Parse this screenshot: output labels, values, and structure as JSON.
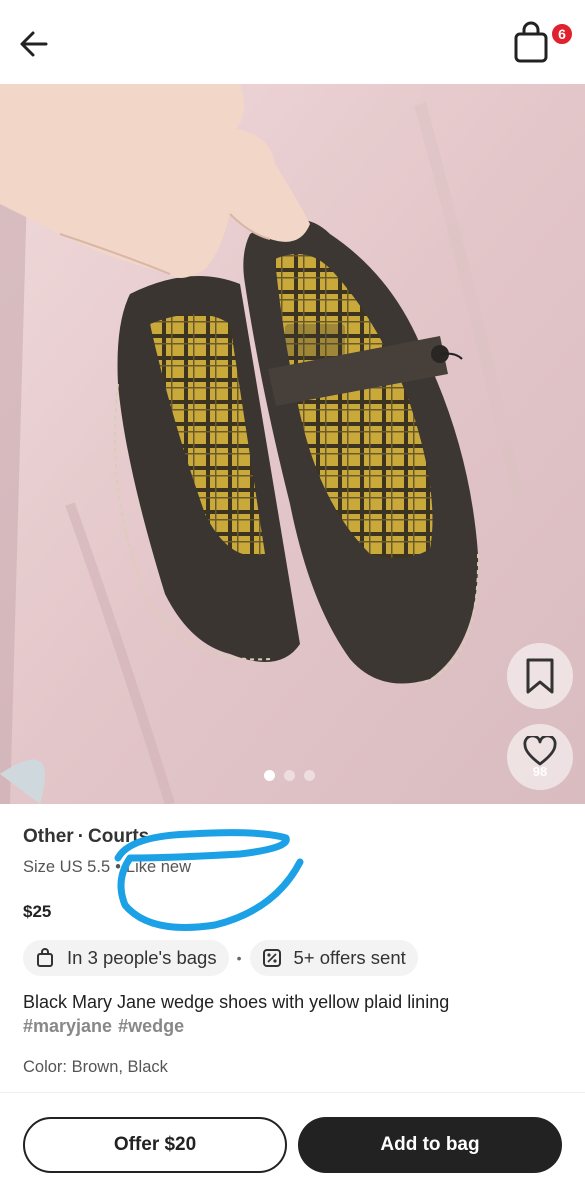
{
  "header": {
    "back_icon": "arrow-left-icon",
    "bag_icon": "shopping-bag-icon",
    "bag_count": "6",
    "badge_color": "#e0212e"
  },
  "gallery": {
    "image_count": 3,
    "active_index": 0,
    "save_icon": "bookmark-icon",
    "like_icon": "heart-icon",
    "like_count": "98"
  },
  "product": {
    "brand": "Other",
    "category": "Courts",
    "separator": "·",
    "size": "Size US 5.5",
    "condition": "Like new",
    "price": "$25",
    "bags_chip": "In 3 people's bags",
    "offers_chip": "5+ offers sent",
    "description": "Black Mary Jane wedge shoes with yellow plaid lining",
    "hashtags": [
      "#maryjane",
      "#wedge"
    ],
    "color_line": "Color: Brown, Black",
    "annotation_color": "#1da1e6"
  },
  "actions": {
    "offer_label": "Offer $20",
    "add_label": "Add to bag"
  }
}
